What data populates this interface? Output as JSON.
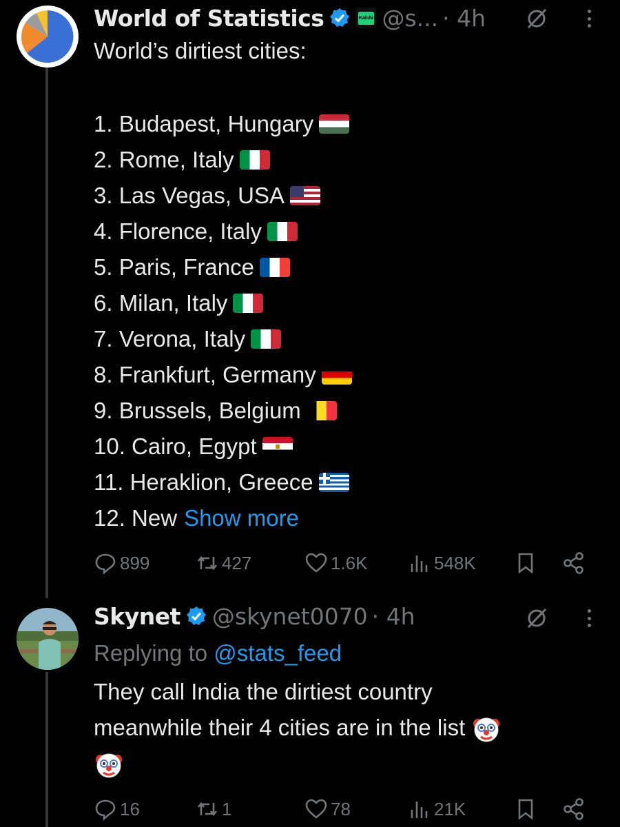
{
  "tweet1": {
    "display_name": "World of Statistics",
    "affiliate_label": "Kalshi",
    "handle": "@s...",
    "time": "· 4h",
    "intro": "World’s dirtiest cities:",
    "list": [
      {
        "text": "1. Budapest, Hungary",
        "flag": "hungary-flag-icon"
      },
      {
        "text": "2. Rome, Italy",
        "flag": "italy-flag-icon"
      },
      {
        "text": "3. Las Vegas, USA",
        "flag": "usa-flag-icon"
      },
      {
        "text": "4. Florence, Italy",
        "flag": "italy-flag-icon"
      },
      {
        "text": "5. Paris, France",
        "flag": "france-flag-icon"
      },
      {
        "text": "6. Milan, Italy",
        "flag": "italy-flag-icon"
      },
      {
        "text": "7. Verona, Italy",
        "flag": "italy-flag-icon"
      },
      {
        "text": "8. Frankfurt, Germany",
        "flag": "germany-flag-icon"
      },
      {
        "text": "9. Brussels, Belgium",
        "flag": "belgium-flag-icon"
      },
      {
        "text": "10. Cairo, Egypt",
        "flag": "egypt-flag-icon"
      },
      {
        "text": "11. Heraklion, Greece",
        "flag": "greece-flag-icon"
      }
    ],
    "truncated_line": "12. New",
    "show_more": "Show more",
    "stats": {
      "replies": "899",
      "reposts": "427",
      "likes": "1.6K",
      "views": "548K"
    }
  },
  "tweet2": {
    "display_name": "Skynet",
    "handle": "@skynet0070",
    "time": "· 4h",
    "replying_prefix": "Replying to",
    "replying_mention": "@stats_feed",
    "text_line1": "They call India the dirtiest country",
    "text_line2": "meanwhile their 4 cities are in the list",
    "stats": {
      "replies": "16",
      "reposts": "1",
      "likes": "78",
      "views": "21K"
    }
  },
  "colors": {
    "background": "#000000",
    "text": "#e7e9ea",
    "muted": "#71767b",
    "link": "#1d9bf0",
    "verified": "#1d9bf0"
  }
}
